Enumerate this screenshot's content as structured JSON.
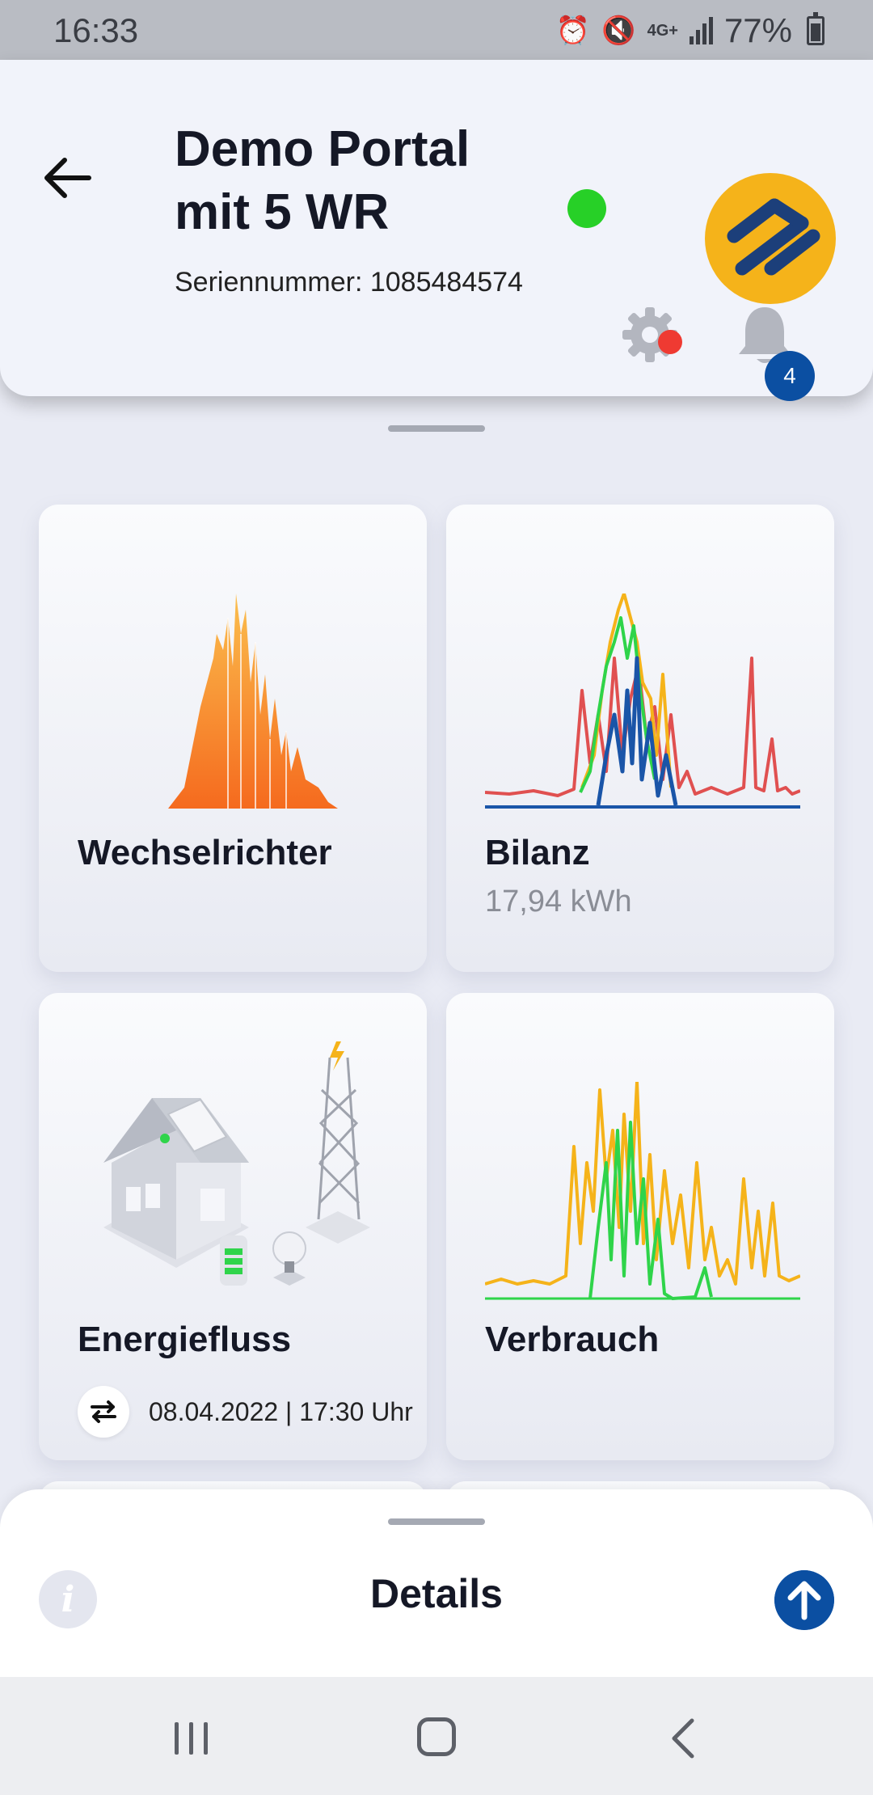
{
  "status_bar": {
    "time": "16:33",
    "network": "4G+",
    "battery": "77%",
    "icons": [
      "alarm-icon",
      "mute-icon",
      "network-4g-icon",
      "signal-icon",
      "battery-icon"
    ]
  },
  "header": {
    "title_line1": "Demo Portal",
    "title_line2": "mit 5 WR",
    "serial": "Seriennummer: 1085484574",
    "online_color": "#27d027",
    "notifications_count": "4",
    "settings_alert_color": "#ef3a32"
  },
  "tiles": {
    "inverter": {
      "title": "Wechselrichter"
    },
    "balance": {
      "title": "Bilanz",
      "value": "17,94 kWh"
    },
    "energy_flow": {
      "title": "Energiefluss",
      "date": "08.04.2022 | 17:30 Uhr"
    },
    "consumption": {
      "title": "Verbrauch"
    }
  },
  "details_sheet": {
    "title": "Details"
  },
  "colors": {
    "accent_blue": "#0b4fa2",
    "logo_yellow": "#f5b31a",
    "chart_orange": "#f77b1c",
    "chart_red": "#e05050",
    "chart_green": "#2fd44a",
    "chart_yellow": "#f5b31a"
  },
  "navigation": [
    "recent-apps",
    "home",
    "back"
  ]
}
